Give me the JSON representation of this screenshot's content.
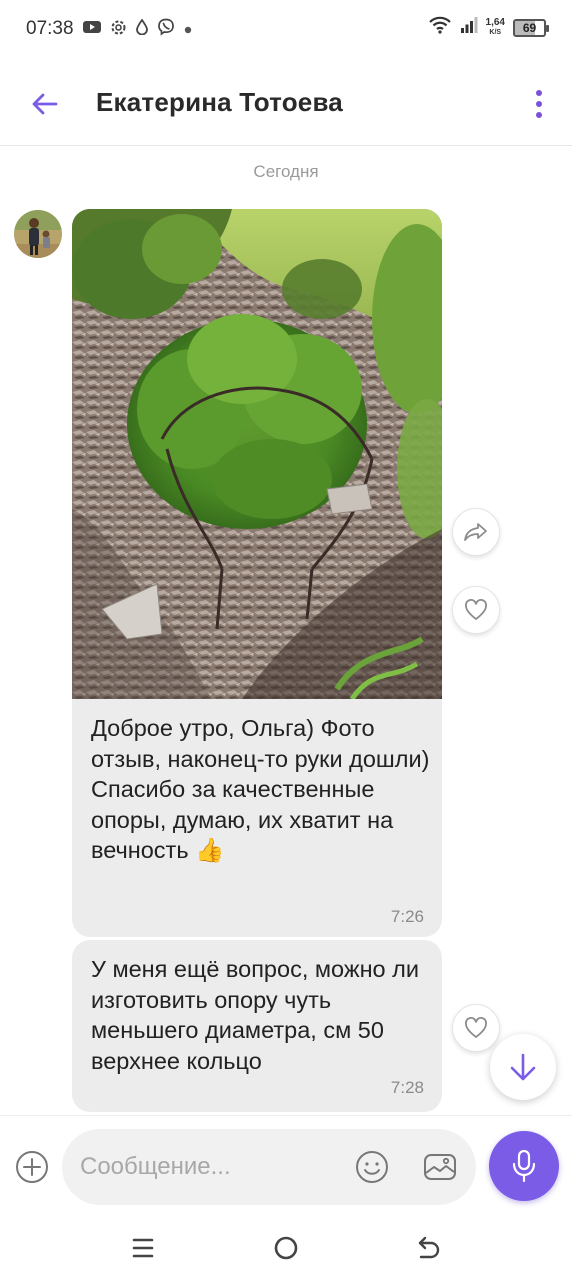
{
  "status_bar": {
    "time": "07:38",
    "net_speed_value": "1,64",
    "net_speed_unit": "K/S",
    "battery": "69"
  },
  "header": {
    "contact_name": "Екатерина Тотоева"
  },
  "chat": {
    "date_separator": "Сегодня",
    "messages": [
      {
        "text": "Доброе утро, Ольга) Фото отзыв, наконец-то руки дошли) Спасибо за качественные опоры, думаю, их хватит на вечность",
        "emoji": "👍",
        "time": "7:26"
      },
      {
        "text": "У меня ещё вопрос, можно ли изготовить опору чуть меньшего диаметра, см 50 верхнее кольцо",
        "time": "7:28"
      }
    ]
  },
  "composer": {
    "placeholder": "Сообщение..."
  },
  "colors": {
    "accent": "#7b5ce6",
    "bubble": "#ececec"
  }
}
